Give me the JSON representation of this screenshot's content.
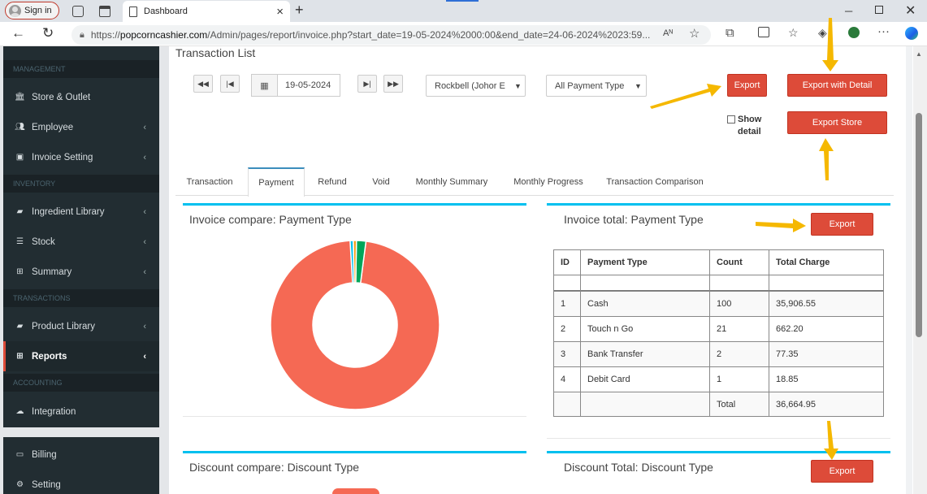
{
  "browser": {
    "signin_label": "Sign in",
    "tab_title": "Dashboard",
    "url_prefix": "https://",
    "url_host": "popcorncashier.com",
    "url_path": "/Admin/pages/report/invoice.php?start_date=19-05-2024%2000:00&end_date=24-06-2024%2023:59...",
    "new_tab_glyph": "+",
    "close_glyph": "×"
  },
  "sidebar": {
    "sections": [
      "MANAGEMENT",
      "INVENTORY",
      "TRANSACTIONS",
      "ACCOUNTING"
    ],
    "items": [
      {
        "label": "Store & Outlet",
        "icon": "bank-icon"
      },
      {
        "label": "Employee",
        "icon": "users-icon"
      },
      {
        "label": "Invoice Setting",
        "icon": "money-icon"
      },
      {
        "label": "Ingredient Library",
        "icon": "book-icon"
      },
      {
        "label": "Stock",
        "icon": "database-icon"
      },
      {
        "label": "Summary",
        "icon": "table-icon"
      },
      {
        "label": "Product Library",
        "icon": "book-icon"
      },
      {
        "label": "Reports",
        "icon": "table-icon"
      },
      {
        "label": "Integration",
        "icon": "cloud-icon"
      },
      {
        "label": "Billing",
        "icon": "credit-card-icon"
      },
      {
        "label": "Setting",
        "icon": "gear-icon"
      }
    ],
    "chevron": "‹"
  },
  "page": {
    "title": "Transaction List",
    "date_value": "19-05-2024",
    "store_select": "Rockbell (Johor E",
    "payment_select": "All Payment Type",
    "export_label": "Export",
    "export_detail_label": "Export with Detail",
    "export_store_label": "Export Store",
    "show_detail_label": "Show detail"
  },
  "tabs": [
    "Transaction",
    "Payment",
    "Refund",
    "Void",
    "Monthly Summary",
    "Monthly Progress",
    "Transaction Comparison"
  ],
  "active_tab": "Payment",
  "panels": {
    "invoice_compare_title": "Invoice compare: Payment Type",
    "invoice_total_title": "Invoice total: Payment Type",
    "discount_compare_title": "Discount compare: Discount Type",
    "discount_total_title": "Discount Total: Discount Type",
    "export_label": "Export"
  },
  "table": {
    "headers": [
      "ID",
      "Payment Type",
      "Count",
      "Total Charge"
    ],
    "rows": [
      [
        "1",
        "Cash",
        "100",
        "35,906.55"
      ],
      [
        "2",
        "Touch n Go",
        "21",
        "662.20"
      ],
      [
        "3",
        "Bank Transfer",
        "2",
        "77.35"
      ],
      [
        "4",
        "Debit Card",
        "1",
        "18.85"
      ]
    ],
    "total_label": "Total",
    "total_value": "36,664.95"
  },
  "chart_data": {
    "type": "pie",
    "categories": [
      "Cash",
      "Touch n Go",
      "Bank Transfer",
      "Debit Card"
    ],
    "values": [
      35906.55,
      662.2,
      77.35,
      18.85
    ],
    "colors": [
      "#f56954",
      "#00a65a",
      "#f39c12",
      "#00c0ef"
    ],
    "title": "Invoice compare: Payment Type"
  },
  "colors": {
    "accent_red": "#dd4b39",
    "box_top": "#00c0ef",
    "sidebar_bg": "#222d32",
    "annotation_arrow": "#f5b800"
  }
}
